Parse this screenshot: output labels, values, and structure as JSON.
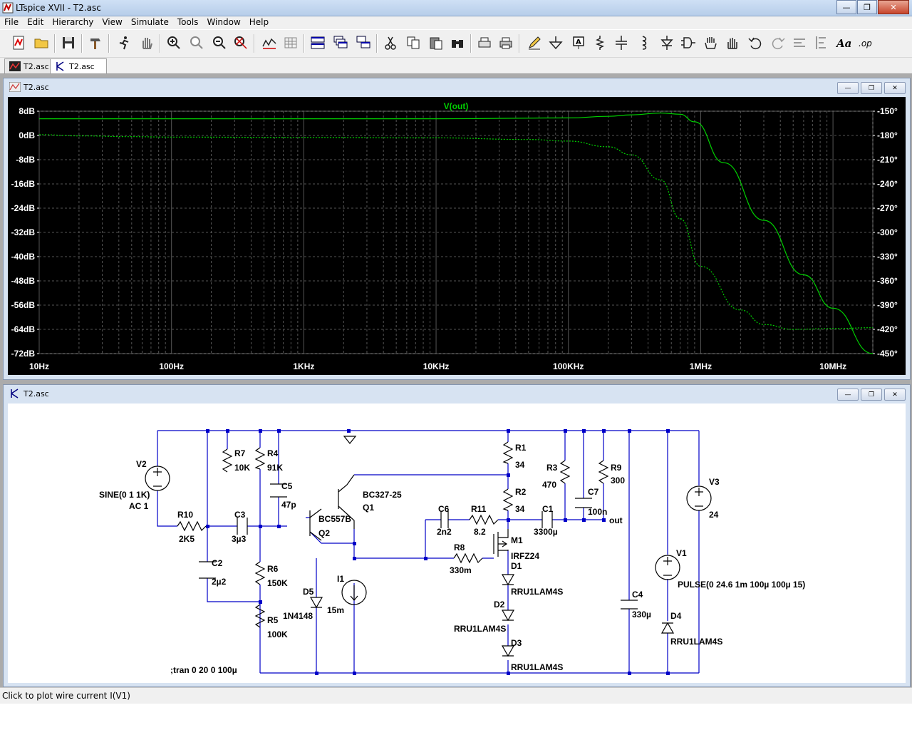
{
  "window": {
    "title": "LTspice XVII - T2.asc"
  },
  "menu": [
    "File",
    "Edit",
    "Hierarchy",
    "View",
    "Simulate",
    "Tools",
    "Window",
    "Help"
  ],
  "tabs": [
    {
      "label": "T2.asc"
    },
    {
      "label": "T2.asc"
    }
  ],
  "plot_window": {
    "title": "T2.asc"
  },
  "schematic_window": {
    "title": "T2.asc"
  },
  "status": {
    "text": "Click to plot wire current I(V1)"
  },
  "colors": {
    "trace": "#00d000",
    "grid": "#555555",
    "plotbg": "#000000",
    "wire": "#0000c8",
    "component": "#000000"
  },
  "chart_data": {
    "type": "line",
    "title": "V(out)",
    "x_scale": "log",
    "xlim": [
      10,
      20000000
    ],
    "x_ticks": [
      {
        "v": 10,
        "label": "10Hz"
      },
      {
        "v": 100,
        "label": "100Hz"
      },
      {
        "v": 1000,
        "label": "1KHz"
      },
      {
        "v": 10000,
        "label": "10KHz"
      },
      {
        "v": 100000,
        "label": "100KHz"
      },
      {
        "v": 1000000,
        "label": "1MHz"
      },
      {
        "v": 10000000,
        "label": "10MHz"
      }
    ],
    "ylim": [
      -72,
      8
    ],
    "y_ticks": [
      "8dB",
      "0dB",
      "-8dB",
      "-16dB",
      "-24dB",
      "-32dB",
      "-40dB",
      "-48dB",
      "-56dB",
      "-64dB",
      "-72dB"
    ],
    "y2lim": [
      -450,
      -150
    ],
    "y2_ticks": [
      "-150°",
      "-180°",
      "-210°",
      "-240°",
      "-270°",
      "-300°",
      "-330°",
      "-360°",
      "-390°",
      "-420°",
      "-450°"
    ],
    "grid": true,
    "series": [
      {
        "name": "V(out)",
        "style": "solid",
        "x": [
          10,
          100,
          1000,
          10000,
          100000,
          200000,
          300000,
          500000,
          700000,
          900000,
          1500000,
          3000000,
          6000000,
          10000000,
          20000000
        ],
        "y": [
          5.5,
          5.5,
          5.5,
          5.5,
          5.8,
          6.3,
          6.8,
          7.4,
          7.0,
          4.5,
          -9,
          -28,
          -46,
          -57,
          -72
        ]
      },
      {
        "name": "",
        "style": "dashed",
        "axis": "y2",
        "x": [
          10,
          20,
          50,
          100,
          1000,
          10000,
          50000,
          100000,
          200000,
          300000,
          500000,
          700000,
          1000000,
          2000000,
          3000000,
          5000000,
          10000000,
          20000000
        ],
        "y": [
          -179,
          -180.5,
          -181.5,
          -182,
          -182.5,
          -183,
          -185,
          -187,
          -194,
          -204,
          -235,
          -283,
          -342,
          -396,
          -414,
          -420,
          -419,
          -418
        ]
      }
    ]
  },
  "schematic": {
    "labels": {
      "V2": "V2",
      "SINE": "SINE(0 1 1K)",
      "AC": "AC 1",
      "R10": "R10",
      "R10v": "2K5",
      "C3": "C3",
      "C3v": "3µ3",
      "R7": "R7",
      "R7v": "10K",
      "R4": "R4",
      "R4v": "91K",
      "C5": "C5",
      "C5v": "47p",
      "C2": "C2",
      "C2v": "2µ2",
      "R6": "R6",
      "R6v": "150K",
      "R5": "R5",
      "R5v": "100K",
      "D5": "D5",
      "D5v": "1N4148",
      "I1": "I1",
      "I1v": "15m",
      "Q1": "Q1",
      "Q1v": "BC327-25",
      "Q2": "Q2",
      "Q2v": "BC557B",
      "R1": "R1",
      "R1v": "34",
      "R2": "R2",
      "R2v": "34",
      "R3": "R3",
      "R3v": "470",
      "C7": "C7",
      "C7v": "100n",
      "R9": "R9",
      "R9v": "300",
      "out": "out",
      "C6": "C6",
      "C6v": "2n2",
      "R11": "R11",
      "R11v": "8.2",
      "C1": "C1",
      "C1v": "3300µ",
      "M1": "M1",
      "M1v": "IRFZ24",
      "R8": "R8",
      "R8v": "330m",
      "D1": "D1",
      "D1v": "RRU1LAM4S",
      "D2": "D2",
      "D2v": "RRU1LAM4S",
      "D3": "D3",
      "D3v": "RRU1LAM4S",
      "C4": "C4",
      "C4v": "330µ",
      "V3": "V3",
      "V3v": "24",
      "V1": "V1",
      "V1v": "PULSE(0 24.6 1m 100µ 100µ 15)",
      "D4": "D4",
      "D4v": "RRU1LAM4S",
      "tran": ";tran 0 20 0 100µ"
    }
  }
}
